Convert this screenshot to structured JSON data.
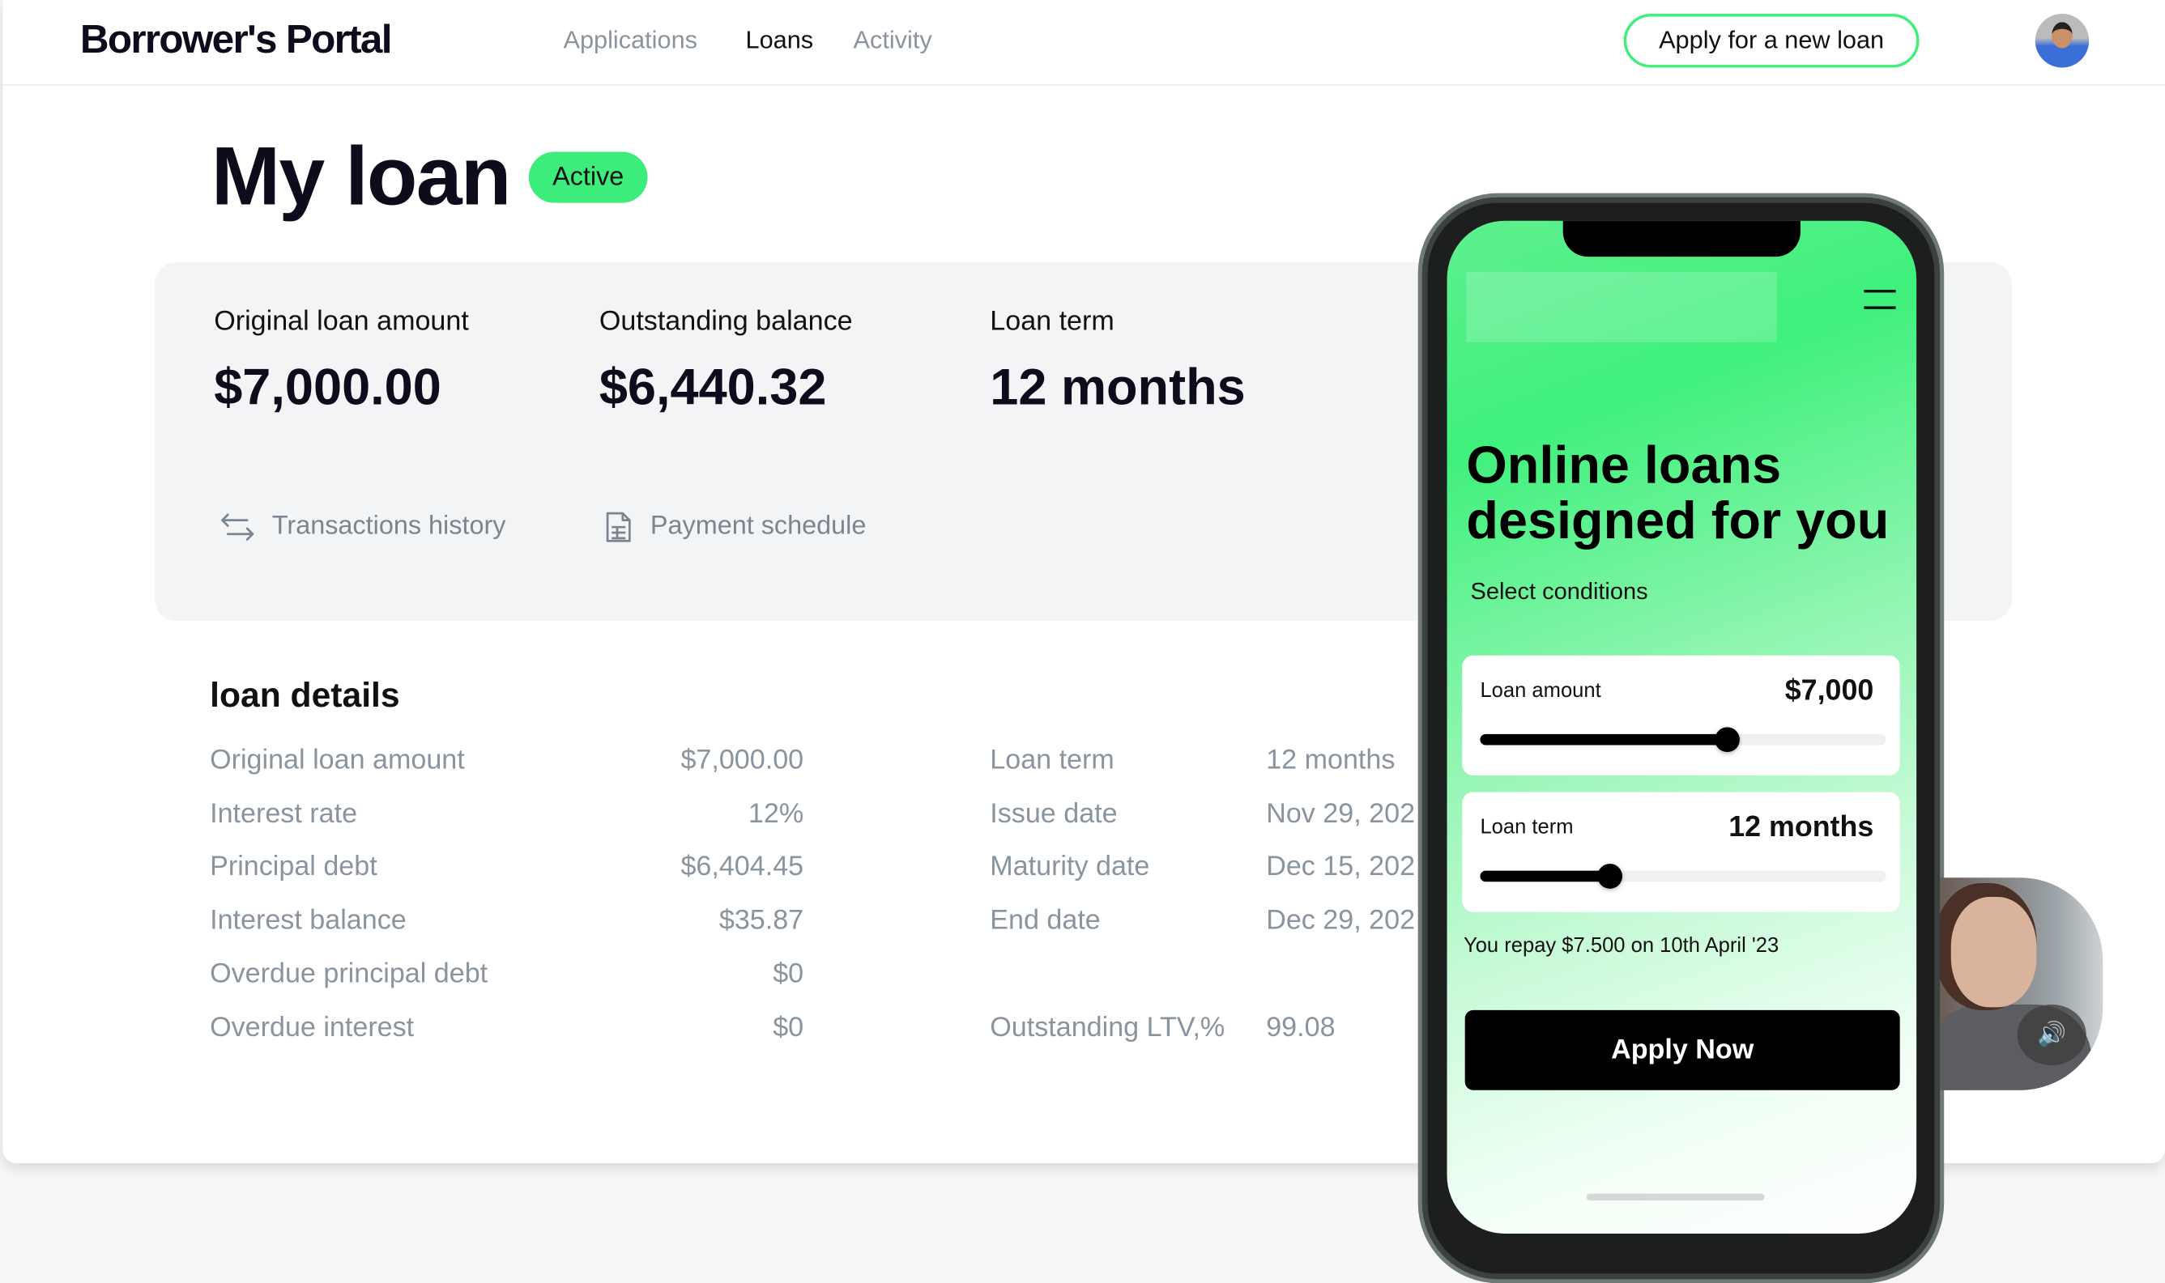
{
  "header": {
    "logo": "Borrower's Portal",
    "nav": [
      {
        "label": "Applications",
        "active": false
      },
      {
        "label": "Loans",
        "active": true
      },
      {
        "label": "Activity",
        "active": false
      }
    ],
    "cta": "Apply for a new loan"
  },
  "page": {
    "title": "My loan",
    "status": "Active"
  },
  "summary": {
    "stats": [
      {
        "label": "Original loan amount",
        "value": "$7,000.00"
      },
      {
        "label": "Outstanding balance",
        "value": "$6,440.32"
      },
      {
        "label": "Loan term",
        "value": "12 months"
      }
    ],
    "links": [
      {
        "label": "Transactions history",
        "icon": "arrows-swap-icon"
      },
      {
        "label": "Payment schedule",
        "icon": "document-icon"
      }
    ]
  },
  "details": {
    "title": "loan details",
    "left": [
      {
        "label": "Original loan amount",
        "value": "$7,000.00"
      },
      {
        "label": "Interest rate",
        "value": "12%"
      },
      {
        "label": "Principal debt",
        "value": "$6,404.45"
      },
      {
        "label": "Interest balance",
        "value": "$35.87"
      },
      {
        "label": "Overdue principal debt",
        "value": "$0"
      },
      {
        "label": "Overdue interest",
        "value": "$0"
      }
    ],
    "right": [
      {
        "label": "Loan term",
        "value": "12 months"
      },
      {
        "label": "Issue date",
        "value": "Nov 29, 202"
      },
      {
        "label": "Maturity date",
        "value": "Dec 15, 202"
      },
      {
        "label": "End date",
        "value": "Dec 29, 202"
      },
      {
        "label": "Outstanding LTV,%",
        "value": "99.08"
      }
    ]
  },
  "phone": {
    "headline": "Online loans designed for you",
    "subtitle": "Select conditions",
    "amount": {
      "label": "Loan amount",
      "value": "$7,000",
      "slider_fraction": 0.61
    },
    "term": {
      "label": "Loan term",
      "value": "12 months",
      "slider_fraction": 0.32
    },
    "repay": "You repay $7.500 on 10th April '23",
    "apply": "Apply Now"
  },
  "colors": {
    "accent": "#3ded7b",
    "panel": "#f3f4f6",
    "muted_text": "#8a949e"
  }
}
